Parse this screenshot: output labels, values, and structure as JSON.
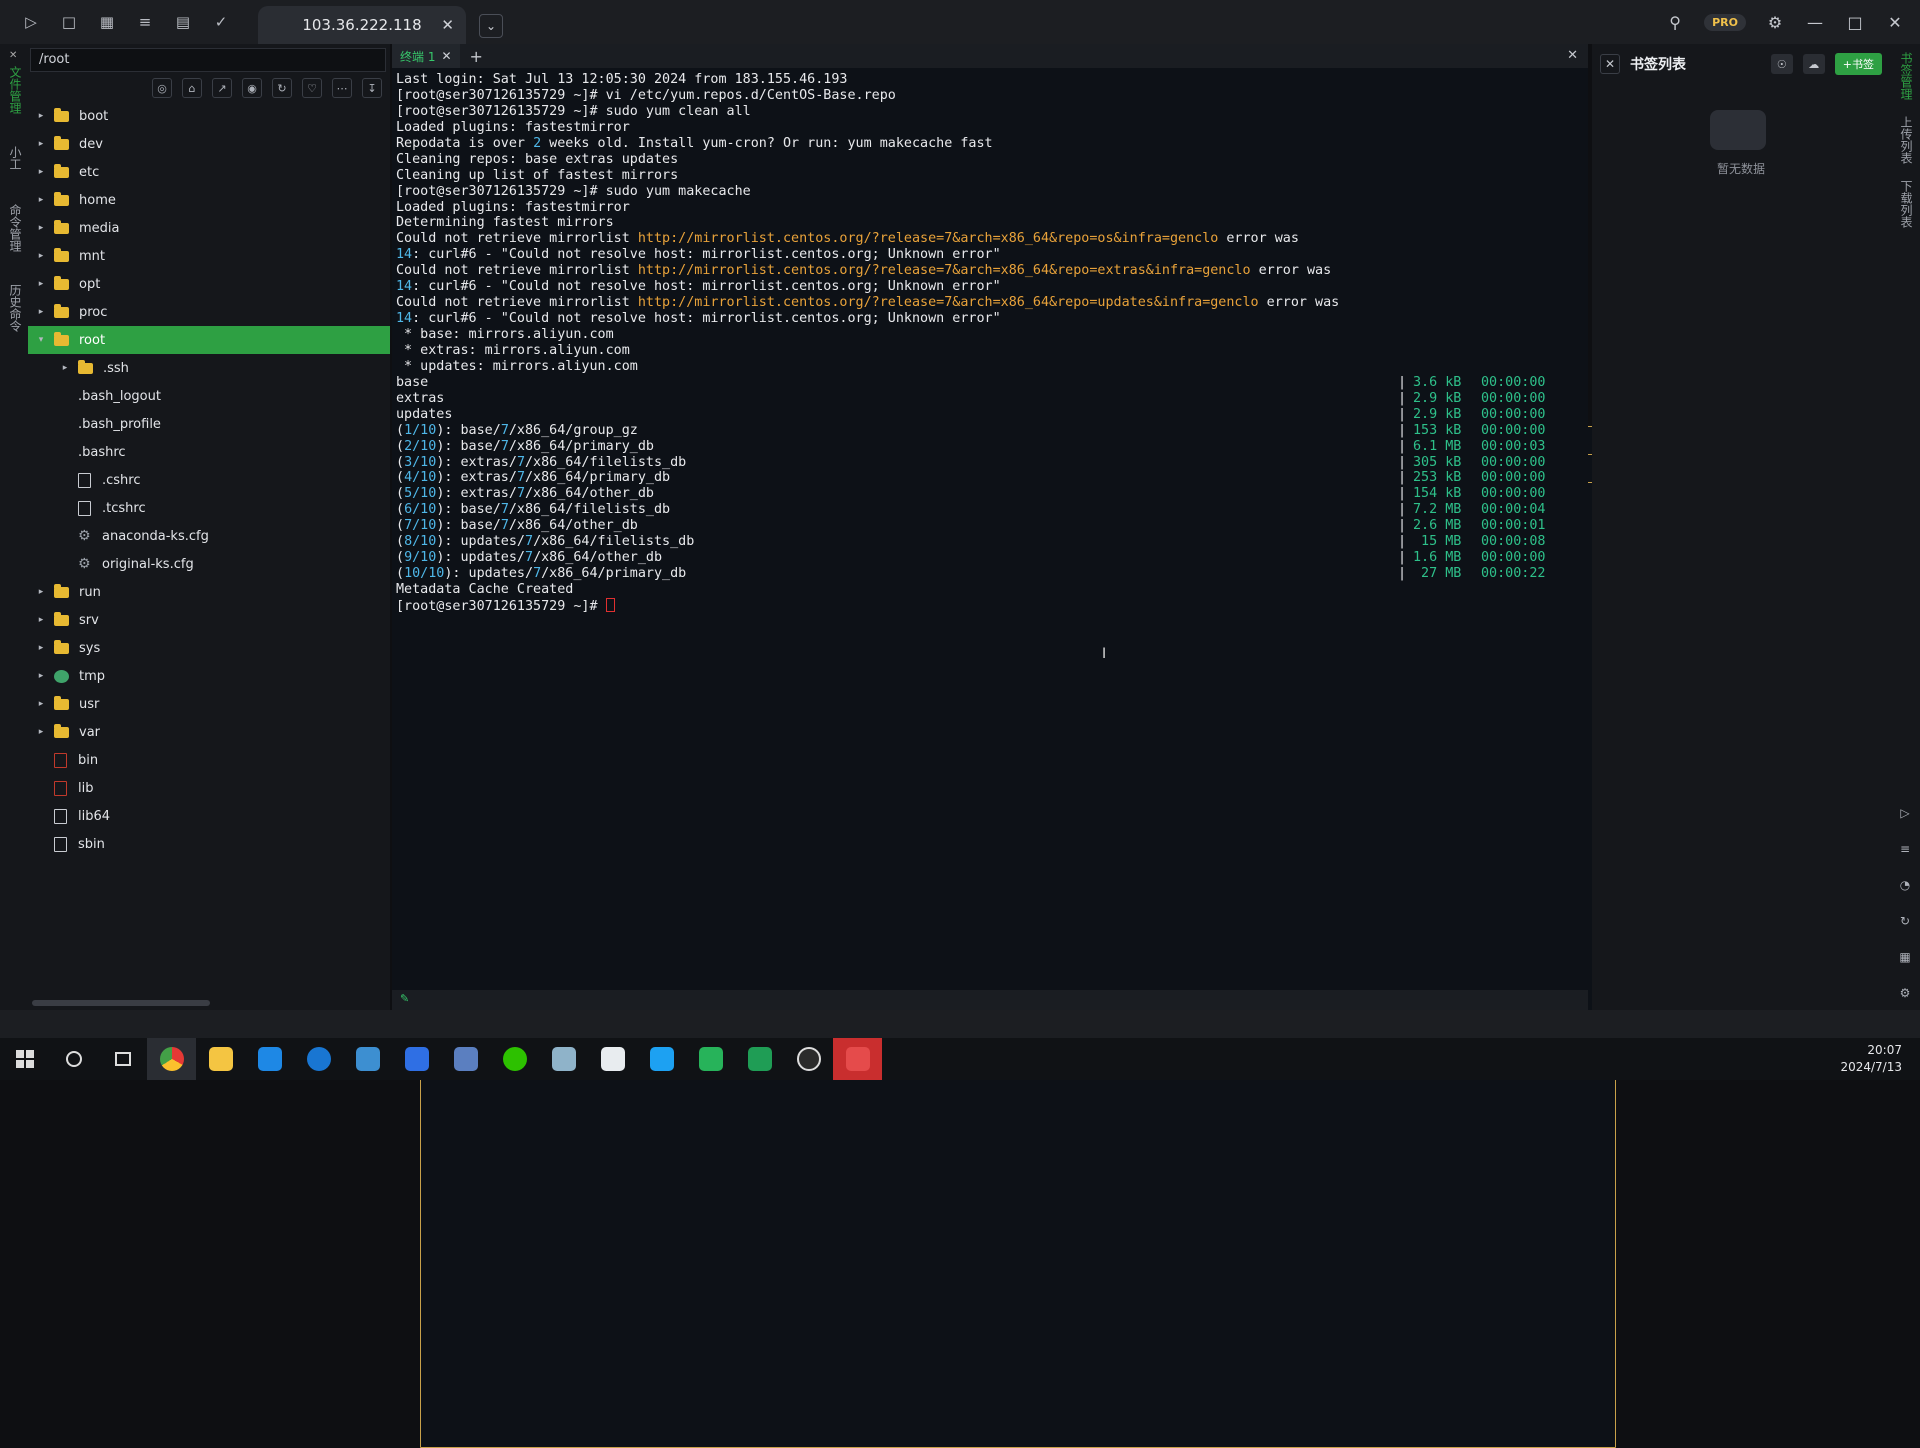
{
  "app": {
    "tab_title": "103.36.222.118",
    "pro_label": "PRO"
  },
  "toolbar_icons": [
    "terminal-icon",
    "file-icon",
    "grid-icon",
    "tree-icon",
    "server-icon",
    "pin-icon"
  ],
  "left_strip": {
    "label_files": "文件管理",
    "label_a": "小工",
    "label_cmd": "命令管理",
    "label_hist": "历史命令"
  },
  "file_panel": {
    "path": "/root",
    "tree": [
      {
        "name": "boot",
        "type": "folder",
        "depth": 0,
        "caret": "▸"
      },
      {
        "name": "dev",
        "type": "folder",
        "depth": 0,
        "caret": "▸"
      },
      {
        "name": "etc",
        "type": "folder",
        "depth": 0,
        "caret": "▸"
      },
      {
        "name": "home",
        "type": "folder",
        "depth": 0,
        "caret": "▸"
      },
      {
        "name": "media",
        "type": "folder",
        "depth": 0,
        "caret": "▸"
      },
      {
        "name": "mnt",
        "type": "folder",
        "depth": 0,
        "caret": "▸"
      },
      {
        "name": "opt",
        "type": "folder",
        "depth": 0,
        "caret": "▸"
      },
      {
        "name": "proc",
        "type": "folder",
        "depth": 0,
        "caret": "▸"
      },
      {
        "name": "root",
        "type": "folder",
        "depth": 0,
        "caret": "▾",
        "selected": true
      },
      {
        "name": ".ssh",
        "type": "folder",
        "depth": 1,
        "caret": "▸"
      },
      {
        "name": ".bash_logout",
        "type": "term",
        "depth": 1,
        "caret": ""
      },
      {
        "name": ".bash_profile",
        "type": "term",
        "depth": 1,
        "caret": ""
      },
      {
        "name": ".bashrc",
        "type": "term",
        "depth": 1,
        "caret": ""
      },
      {
        "name": ".cshrc",
        "type": "file",
        "depth": 1,
        "caret": ""
      },
      {
        "name": ".tcshrc",
        "type": "file",
        "depth": 1,
        "caret": ""
      },
      {
        "name": "anaconda-ks.cfg",
        "type": "gear",
        "depth": 1,
        "caret": ""
      },
      {
        "name": "original-ks.cfg",
        "type": "gear",
        "depth": 1,
        "caret": ""
      },
      {
        "name": "run",
        "type": "folder",
        "depth": 0,
        "caret": "▸"
      },
      {
        "name": "srv",
        "type": "folder",
        "depth": 0,
        "caret": "▸"
      },
      {
        "name": "sys",
        "type": "folder",
        "depth": 0,
        "caret": "▸"
      },
      {
        "name": "tmp",
        "type": "globe",
        "depth": 0,
        "caret": "▸"
      },
      {
        "name": "usr",
        "type": "folder",
        "depth": 0,
        "caret": "▸"
      },
      {
        "name": "var",
        "type": "folder",
        "depth": 0,
        "caret": "▸"
      },
      {
        "name": "bin",
        "type": "red",
        "depth": 0,
        "caret": ""
      },
      {
        "name": "lib",
        "type": "red",
        "depth": 0,
        "caret": ""
      },
      {
        "name": "lib64",
        "type": "file",
        "depth": 0,
        "caret": ""
      },
      {
        "name": "sbin",
        "type": "file",
        "depth": 0,
        "caret": ""
      }
    ]
  },
  "terminal": {
    "tab_label": "终端 1",
    "lines": [
      [
        {
          "t": "Last login: Sat Jul 13 12:05:30 2024 from 183.155.46.193"
        }
      ],
      [
        {
          "t": "[root@ser307126135729 ~]# vi /etc/yum.repos.d/CentOS-Base.repo"
        }
      ],
      [
        {
          "t": "[root@ser307126135729 ~]# sudo yum clean all"
        }
      ],
      [
        {
          "t": "Loaded plugins: fastestmirror"
        }
      ],
      [
        {
          "t": "Repodata is over "
        },
        {
          "t": "2",
          "c": "num"
        },
        {
          "t": " weeks old. Install yum-cron? Or run: yum makecache fast"
        }
      ],
      [
        {
          "t": "Cleaning repos: base extras updates"
        }
      ],
      [
        {
          "t": "Cleaning up list of fastest mirrors"
        }
      ],
      [
        {
          "t": "[root@ser307126135729 ~]# sudo yum makecache"
        }
      ],
      [
        {
          "t": "Loaded plugins: fastestmirror"
        }
      ],
      [
        {
          "t": "Determining fastest mirrors"
        }
      ],
      [
        {
          "t": "Could not retrieve mirrorlist "
        },
        {
          "t": "http://mirrorlist.centos.org/?release=7&arch=x86_64&repo=os&infra=genclo",
          "c": "url"
        },
        {
          "t": " error was"
        }
      ],
      [
        {
          "t": "14",
          "c": "num"
        },
        {
          "t": ": curl#6 - \"Could not resolve host: mirrorlist.centos.org; Unknown error\""
        }
      ],
      [
        {
          "t": "Could not retrieve mirrorlist "
        },
        {
          "t": "http://mirrorlist.centos.org/?release=7&arch=x86_64&repo=extras&infra=genclo",
          "c": "url"
        },
        {
          "t": " error was"
        }
      ],
      [
        {
          "t": "14",
          "c": "num"
        },
        {
          "t": ": curl#6 - \"Could not resolve host: mirrorlist.centos.org; Unknown error\""
        }
      ],
      [
        {
          "t": "Could not retrieve mirrorlist "
        },
        {
          "t": "http://mirrorlist.centos.org/?release=7&arch=x86_64&repo=updates&infra=genclo",
          "c": "url"
        },
        {
          "t": " error was"
        }
      ],
      [
        {
          "t": "14",
          "c": "num"
        },
        {
          "t": ": curl#6 - \"Could not resolve host: mirrorlist.centos.org; Unknown error\""
        }
      ],
      [
        {
          "t": " * base: mirrors.aliyun.com"
        }
      ],
      [
        {
          "t": " * extras: mirrors.aliyun.com"
        }
      ],
      [
        {
          "t": " * updates: mirrors.aliyun.com"
        }
      ]
    ],
    "downloads": [
      {
        "name": [
          {
            "t": "base"
          }
        ],
        "size": "3.6 kB",
        "time": "00:00:00"
      },
      {
        "name": [
          {
            "t": "extras"
          }
        ],
        "size": "2.9 kB",
        "time": "00:00:00"
      },
      {
        "name": [
          {
            "t": "updates"
          }
        ],
        "size": "2.9 kB",
        "time": "00:00:00"
      },
      {
        "name": [
          {
            "t": "("
          },
          {
            "t": "1/10",
            "c": "num"
          },
          {
            "t": "): base/"
          },
          {
            "t": "7",
            "c": "num"
          },
          {
            "t": "/x86_64/group_gz"
          }
        ],
        "size": "153 kB",
        "time": "00:00:00"
      },
      {
        "name": [
          {
            "t": "("
          },
          {
            "t": "2/10",
            "c": "num"
          },
          {
            "t": "): base/"
          },
          {
            "t": "7",
            "c": "num"
          },
          {
            "t": "/x86_64/primary_db"
          }
        ],
        "size": "6.1 MB",
        "time": "00:00:03"
      },
      {
        "name": [
          {
            "t": "("
          },
          {
            "t": "3/10",
            "c": "num"
          },
          {
            "t": "): extras/"
          },
          {
            "t": "7",
            "c": "num"
          },
          {
            "t": "/x86_64/filelists_db"
          }
        ],
        "size": "305 kB",
        "time": "00:00:00"
      },
      {
        "name": [
          {
            "t": "("
          },
          {
            "t": "4/10",
            "c": "num"
          },
          {
            "t": "): extras/"
          },
          {
            "t": "7",
            "c": "num"
          },
          {
            "t": "/x86_64/primary_db"
          }
        ],
        "size": "253 kB",
        "time": "00:00:00"
      },
      {
        "name": [
          {
            "t": "("
          },
          {
            "t": "5/10",
            "c": "num"
          },
          {
            "t": "): extras/"
          },
          {
            "t": "7",
            "c": "num"
          },
          {
            "t": "/x86_64/other_db"
          }
        ],
        "size": "154 kB",
        "time": "00:00:00"
      },
      {
        "name": [
          {
            "t": "("
          },
          {
            "t": "6/10",
            "c": "num"
          },
          {
            "t": "): base/"
          },
          {
            "t": "7",
            "c": "num"
          },
          {
            "t": "/x86_64/filelists_db"
          }
        ],
        "size": "7.2 MB",
        "time": "00:00:04"
      },
      {
        "name": [
          {
            "t": "("
          },
          {
            "t": "7/10",
            "c": "num"
          },
          {
            "t": "): base/"
          },
          {
            "t": "7",
            "c": "num"
          },
          {
            "t": "/x86_64/other_db"
          }
        ],
        "size": "2.6 MB",
        "time": "00:00:01"
      },
      {
        "name": [
          {
            "t": "("
          },
          {
            "t": "8/10",
            "c": "num"
          },
          {
            "t": "): updates/"
          },
          {
            "t": "7",
            "c": "num"
          },
          {
            "t": "/x86_64/filelists_db"
          }
        ],
        "size": " 15 MB",
        "time": "00:00:08"
      },
      {
        "name": [
          {
            "t": "("
          },
          {
            "t": "9/10",
            "c": "num"
          },
          {
            "t": "): updates/"
          },
          {
            "t": "7",
            "c": "num"
          },
          {
            "t": "/x86_64/other_db"
          }
        ],
        "size": "1.6 MB",
        "time": "00:00:00"
      },
      {
        "name": [
          {
            "t": "("
          },
          {
            "t": "10/10",
            "c": "num"
          },
          {
            "t": "): updates/"
          },
          {
            "t": "7",
            "c": "num"
          },
          {
            "t": "/x86_64/primary_db"
          }
        ],
        "size": " 27 MB",
        "time": "00:00:22"
      }
    ],
    "tail": [
      "Metadata Cache Created"
    ],
    "prompt": "[root@ser307126135729 ~]# "
  },
  "bookmarks": {
    "title": "书签列表",
    "add_label": "+书签",
    "empty_text": "暂无数据"
  },
  "right_strip": {
    "label_bm": "书签管理",
    "label_up": "上传列表",
    "label_down": "下载列表"
  },
  "taskbar": {
    "time": "20:07",
    "date": "2024/7/13"
  },
  "colors": {
    "accent": "#2ea043",
    "url": "#e8a23a",
    "number": "#4fb7e8",
    "size": "#2ec08a"
  }
}
